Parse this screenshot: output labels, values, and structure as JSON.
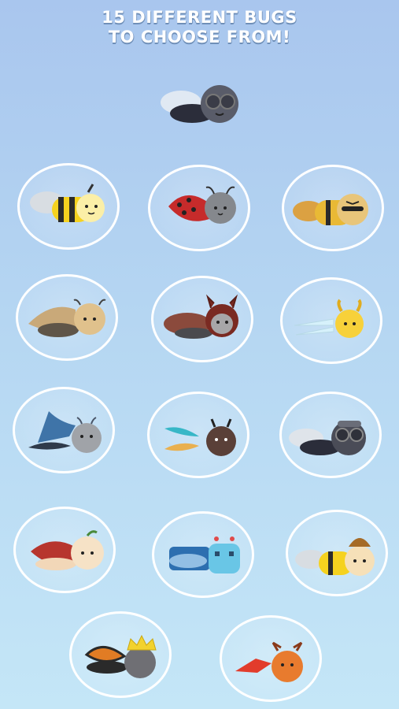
{
  "title": {
    "line1": "15 DIFFERENT BUGS",
    "line2": "TO CHOOSE FROM!"
  },
  "featured_bug": {
    "icon": "fly-with-goggles-icon"
  },
  "bugs": [
    {
      "icon": "bee-icon"
    },
    {
      "icon": "ladybug-icon"
    },
    {
      "icon": "cool-bee-with-sunglasses-icon"
    },
    {
      "icon": "moth-icon"
    },
    {
      "icon": "horned-beetle-icon"
    },
    {
      "icon": "yellow-dragonfly-icon"
    },
    {
      "icon": "wizard-hat-bug-icon"
    },
    {
      "icon": "teal-wing-fly-icon"
    },
    {
      "icon": "goggles-fly-icon"
    },
    {
      "icon": "apple-bug-icon"
    },
    {
      "icon": "robot-bug-icon"
    },
    {
      "icon": "honey-hat-bee-icon"
    },
    {
      "icon": "monarch-king-bug-icon"
    },
    {
      "icon": "orange-fish-bug-icon"
    }
  ],
  "colors": {
    "bg_top": "#a9c6ee",
    "bg_bottom": "#c4e6f7",
    "bubble_border": "#ffffff",
    "title_text": "#ffffff"
  }
}
